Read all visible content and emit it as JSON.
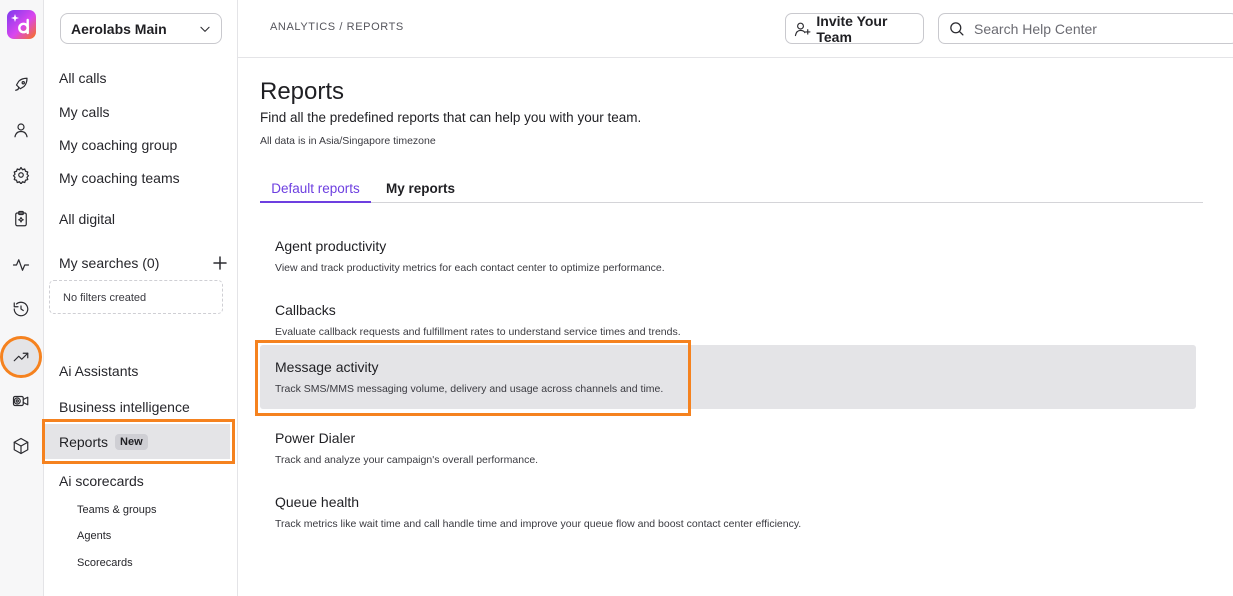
{
  "rail": {
    "icons": [
      "rocket-icon",
      "user-icon",
      "gear-icon",
      "clipboard-sparkle-icon",
      "activity-icon",
      "history-icon",
      "trending-up-icon",
      "video-gear-icon",
      "cube-icon"
    ],
    "active": "trending-up-icon"
  },
  "sidebar": {
    "workspace": "Aerolabs Main",
    "items": [
      {
        "label": "All calls"
      },
      {
        "label": "My calls"
      },
      {
        "label": "My coaching group"
      },
      {
        "label": "My coaching teams"
      },
      {
        "label": "All digital"
      }
    ],
    "searches_label": "My searches (0)",
    "no_filters": "No filters created",
    "items2": [
      {
        "label": "Ai Assistants"
      },
      {
        "label": "Business intelligence"
      }
    ],
    "reports_label": "Reports",
    "reports_badge": "New",
    "scorecards_label": "Ai scorecards",
    "sub_items": [
      {
        "label": "Teams & groups"
      },
      {
        "label": "Agents"
      },
      {
        "label": "Scorecards"
      }
    ]
  },
  "topbar": {
    "breadcrumb": "ANALYTICS / REPORTS",
    "invite_label": "Invite Your Team",
    "search_placeholder": "Search Help Center"
  },
  "main": {
    "title": "Reports",
    "subtitle": "Find all the predefined reports that can help you with your team.",
    "timezone": "All data is in Asia/Singapore timezone",
    "tabs": [
      {
        "label": "Default reports",
        "active": true
      },
      {
        "label": "My reports",
        "active": false
      }
    ],
    "reports": [
      {
        "title": "Agent productivity",
        "desc": "View and track productivity metrics for each contact center to optimize performance."
      },
      {
        "title": "Callbacks",
        "desc": "Evaluate callback requests and fulfillment rates to understand service times and trends."
      },
      {
        "title": "Message activity",
        "desc": "Track SMS/MMS messaging volume, delivery and usage across channels and time."
      },
      {
        "title": "Power Dialer",
        "desc": "Track and analyze your campaign's overall performance."
      },
      {
        "title": "Queue health",
        "desc": "Track metrics like wait time and call handle time and improve your queue flow and boost contact center efficiency."
      }
    ]
  },
  "colors": {
    "accent": "#6d3fe0",
    "highlight_outline": "#f5821f",
    "selected_bg": "#e4e4e7"
  }
}
